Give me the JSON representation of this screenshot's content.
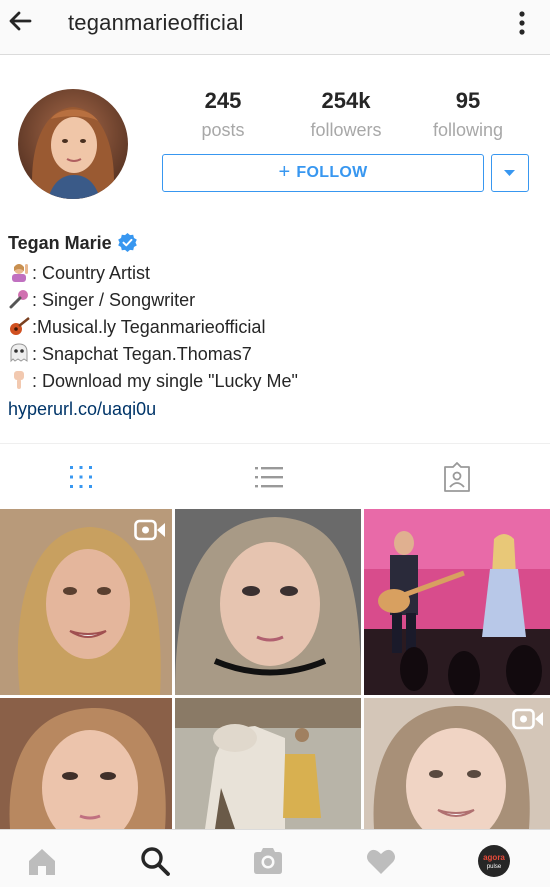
{
  "header": {
    "title": "teganmarieofficial",
    "back_icon": "back-arrow-icon",
    "menu_icon": "more-vertical-icon"
  },
  "profile": {
    "stats": [
      {
        "value": "245",
        "label": "posts"
      },
      {
        "value": "254k",
        "label": "followers"
      },
      {
        "value": "95",
        "label": "following"
      }
    ],
    "follow_label": "FOLLOW",
    "full_name": "Tegan Marie",
    "verified": true,
    "bio": [
      {
        "emoji": "woman-raising-hand",
        "text": ": Country Artist"
      },
      {
        "emoji": "microphone",
        "text": ": Singer / Songwriter"
      },
      {
        "emoji": "guitar",
        "text": ":Musical.ly Teganmarieofficial"
      },
      {
        "emoji": "ghost",
        "text": ": Snapchat Tegan.Thomas7"
      },
      {
        "emoji": "pointing-down",
        "text": ": Download my single \"Lucky Me\""
      }
    ],
    "link": "hyperurl.co/uaqi0u"
  },
  "tabs": [
    {
      "name": "grid",
      "icon": "grid-icon",
      "active": true
    },
    {
      "name": "list",
      "icon": "list-icon",
      "active": false
    },
    {
      "name": "tagged",
      "icon": "tagged-photos-icon",
      "active": false
    }
  ],
  "grid": [
    {
      "video": true
    },
    {
      "video": false
    },
    {
      "video": false
    },
    {
      "video": false
    },
    {
      "video": false
    },
    {
      "video": true
    }
  ],
  "bottom_nav": [
    {
      "icon": "home-icon"
    },
    {
      "icon": "search-icon"
    },
    {
      "icon": "camera-icon"
    },
    {
      "icon": "heart-icon"
    },
    {
      "icon": "profile-avatar-icon"
    }
  ],
  "watermark": "agora pulse",
  "colors": {
    "accent": "#3897f0",
    "link": "#003569",
    "muted": "#a8a8a8"
  }
}
